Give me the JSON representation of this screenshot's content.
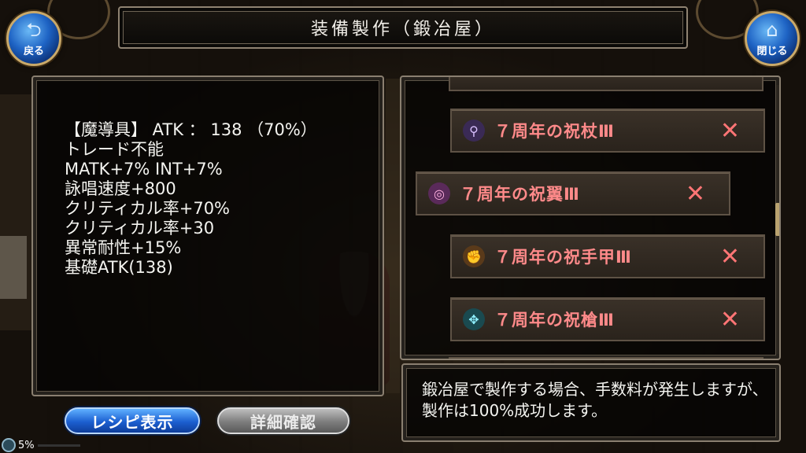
{
  "header": {
    "title": "装備製作（鍛冶屋）",
    "back_label": "戻る",
    "close_label": "閉じる"
  },
  "item_stats": {
    "lines": [
      "【魔導具】 ATK ： 138 （70%）",
      "トレード不能",
      "MATK+7% INT+7%",
      "詠唱速度+800",
      "クリティカル率+70%",
      "クリティカル率+30",
      "異常耐性+15%",
      "基礎ATK(138)"
    ]
  },
  "recipes": [
    {
      "name": "７周年の祝杖Ⅲ",
      "mark": "✕",
      "icon": "staff-icon",
      "selected": false
    },
    {
      "name": "７周年の祝翼Ⅲ",
      "mark": "✕",
      "icon": "wing-icon",
      "selected": true
    },
    {
      "name": "７周年の祝手甲Ⅲ",
      "mark": "✕",
      "icon": "gauntlet-icon",
      "selected": false
    },
    {
      "name": "７周年の祝槍Ⅲ",
      "mark": "✕",
      "icon": "spear-icon",
      "selected": false
    }
  ],
  "message": "鍛冶屋で製作する場合、手数料が発生しますが、製作は100%成功します。",
  "buttons": {
    "recipe_label": "レシピ表示",
    "detail_label": "詳細確認"
  },
  "progress": {
    "label": "5%",
    "value": 0.05
  },
  "colors": {
    "recipe_text": "#ff8a8a",
    "accent_blue": "#1c5fd0",
    "frame": "#8a7f70"
  }
}
